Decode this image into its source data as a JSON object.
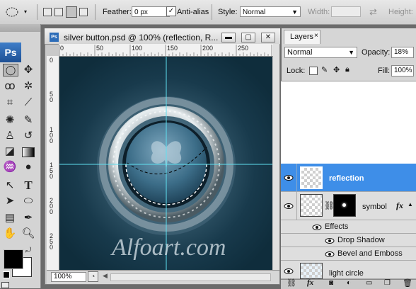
{
  "options_bar": {
    "feather_label": "Feather:",
    "feather_value": "0 px",
    "antialias_label": "Anti-alias",
    "antialias_checked": true,
    "style_label": "Style:",
    "style_value": "Normal",
    "width_label": "Width:",
    "height_label": "Height:",
    "swap_icon": "swap-arrows-icon"
  },
  "tools": {
    "app_logo": "Ps",
    "items": [
      "marquee-ellipse",
      "move",
      "lasso",
      "magic-wand",
      "crop",
      "slice",
      "healing",
      "brush",
      "stamp",
      "history-brush",
      "eraser",
      "gradient",
      "blur",
      "dodge",
      "path-select",
      "type",
      "direct-select",
      "shape",
      "notes",
      "eyedropper",
      "hand",
      "zoom"
    ],
    "foreground_color": "#000000",
    "background_color": "#ffffff"
  },
  "document": {
    "title": "silver button.psd @ 100% (reflection, R...",
    "ps_badge": "Ps",
    "zoom": "100%",
    "ruler_h": [
      "0",
      "50",
      "100",
      "150",
      "200",
      "250"
    ],
    "ruler_v": [
      "0",
      "5\n0",
      "1\n0\n0",
      "1\n5\n0",
      "2\n0\n0",
      "2\n5\n0"
    ],
    "watermark": "Alfoart.com",
    "canvas_bg": "#123345",
    "guide_color": "#5fe0f0"
  },
  "layers_panel": {
    "tab_label": "Layers",
    "blend_mode": "Normal",
    "opacity_label": "Opacity:",
    "opacity_value": "18%",
    "lock_label": "Lock:",
    "fill_label": "Fill:",
    "fill_value": "100%",
    "layers": [
      {
        "name": "reflection",
        "selected": true
      },
      {
        "name": "symbol",
        "fx": "fx",
        "effects_label": "Effects",
        "effects": [
          "Drop Shadow",
          "Bevel and Emboss"
        ]
      },
      {
        "name": "light circle"
      }
    ],
    "selected_color": "#3e8ee8"
  }
}
